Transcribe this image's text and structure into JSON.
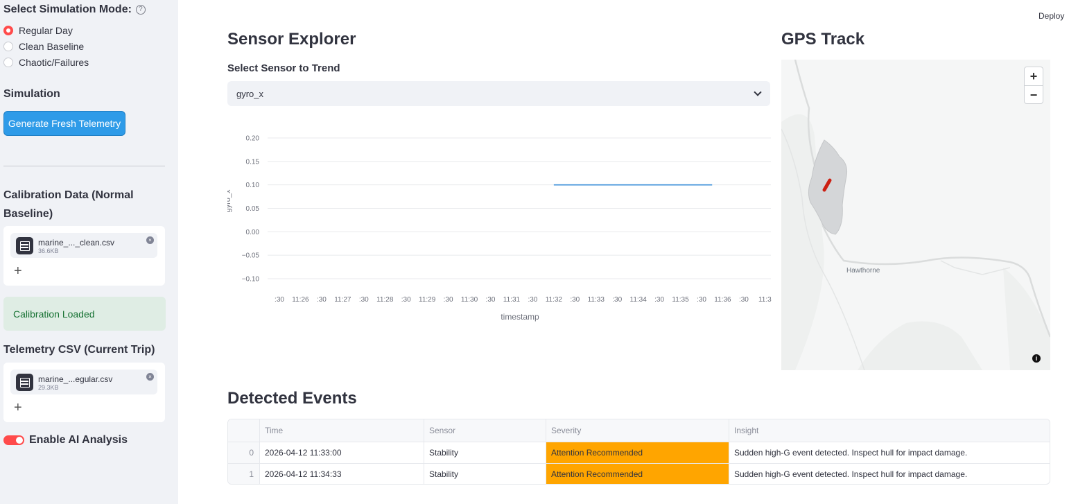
{
  "sidebar": {
    "mode_title": "Select Simulation Mode:",
    "modes": [
      {
        "label": "Regular Day",
        "selected": true
      },
      {
        "label": "Clean Baseline",
        "selected": false
      },
      {
        "label": "Chaotic/Failures",
        "selected": false
      }
    ],
    "simulation_heading": "Simulation",
    "generate_button": "Generate Fresh Telemetry",
    "calibration_heading": "Calibration Data (Normal Baseline)",
    "calibration_file": {
      "name": "marine_..._clean.csv",
      "size": "36.6KB"
    },
    "calibration_status": "Calibration Loaded",
    "telemetry_heading": "Telemetry CSV (Current Trip)",
    "telemetry_file": {
      "name": "marine_...egular.csv",
      "size": "29.3KB"
    },
    "ai_toggle_label": "Enable AI Analysis",
    "ai_toggle_on": true,
    "add_symbol": "+",
    "remove_symbol": "×"
  },
  "header": {
    "deploy_label": "Deploy"
  },
  "sensor_explorer": {
    "title": "Sensor Explorer",
    "select_label": "Select Sensor to Trend",
    "selected_sensor": "gyro_x"
  },
  "chart_data": {
    "type": "line",
    "xlabel": "timestamp",
    "ylabel": "gyro_x",
    "y_ticks": [
      "0.20",
      "0.15",
      "0.10",
      "0.05",
      "0.00",
      "−0.05",
      "−0.10"
    ],
    "ylim": [
      -0.1,
      0.2
    ],
    "x_ticks": [
      ":30",
      "11:26",
      ":30",
      "11:27",
      ":30",
      "11:28",
      ":30",
      "11:29",
      ":30",
      "11:30",
      ":30",
      "11:31",
      ":30",
      "11:32",
      ":30",
      "11:33",
      ":30",
      "11:34",
      ":30",
      "11:35",
      ":30",
      "11:36",
      ":30",
      "11:3"
    ],
    "series": [
      {
        "x": [
          "11:32",
          "11:35:45"
        ],
        "values": [
          0.1,
          0.1
        ],
        "color": "#3b8fd9"
      }
    ]
  },
  "gps": {
    "title": "GPS Track",
    "place_label": "Hawthorne",
    "zoom_in": "+",
    "zoom_out": "−",
    "info": "i",
    "track_color": "#cc1f12"
  },
  "events": {
    "title": "Detected Events",
    "columns": [
      "",
      "Time",
      "Sensor",
      "Severity",
      "Insight"
    ],
    "rows": [
      {
        "idx": "0",
        "time": "2026-04-12 11:33:00",
        "sensor": "Stability",
        "severity": "Attention Recommended",
        "insight": "Sudden high-G event detected. Inspect hull for impact damage."
      },
      {
        "idx": "1",
        "time": "2026-04-12 11:34:33",
        "sensor": "Stability",
        "severity": "Attention Recommended",
        "insight": "Sudden high-G event detected. Inspect hull for impact damage."
      }
    ],
    "severity_color": "#ffa500"
  }
}
